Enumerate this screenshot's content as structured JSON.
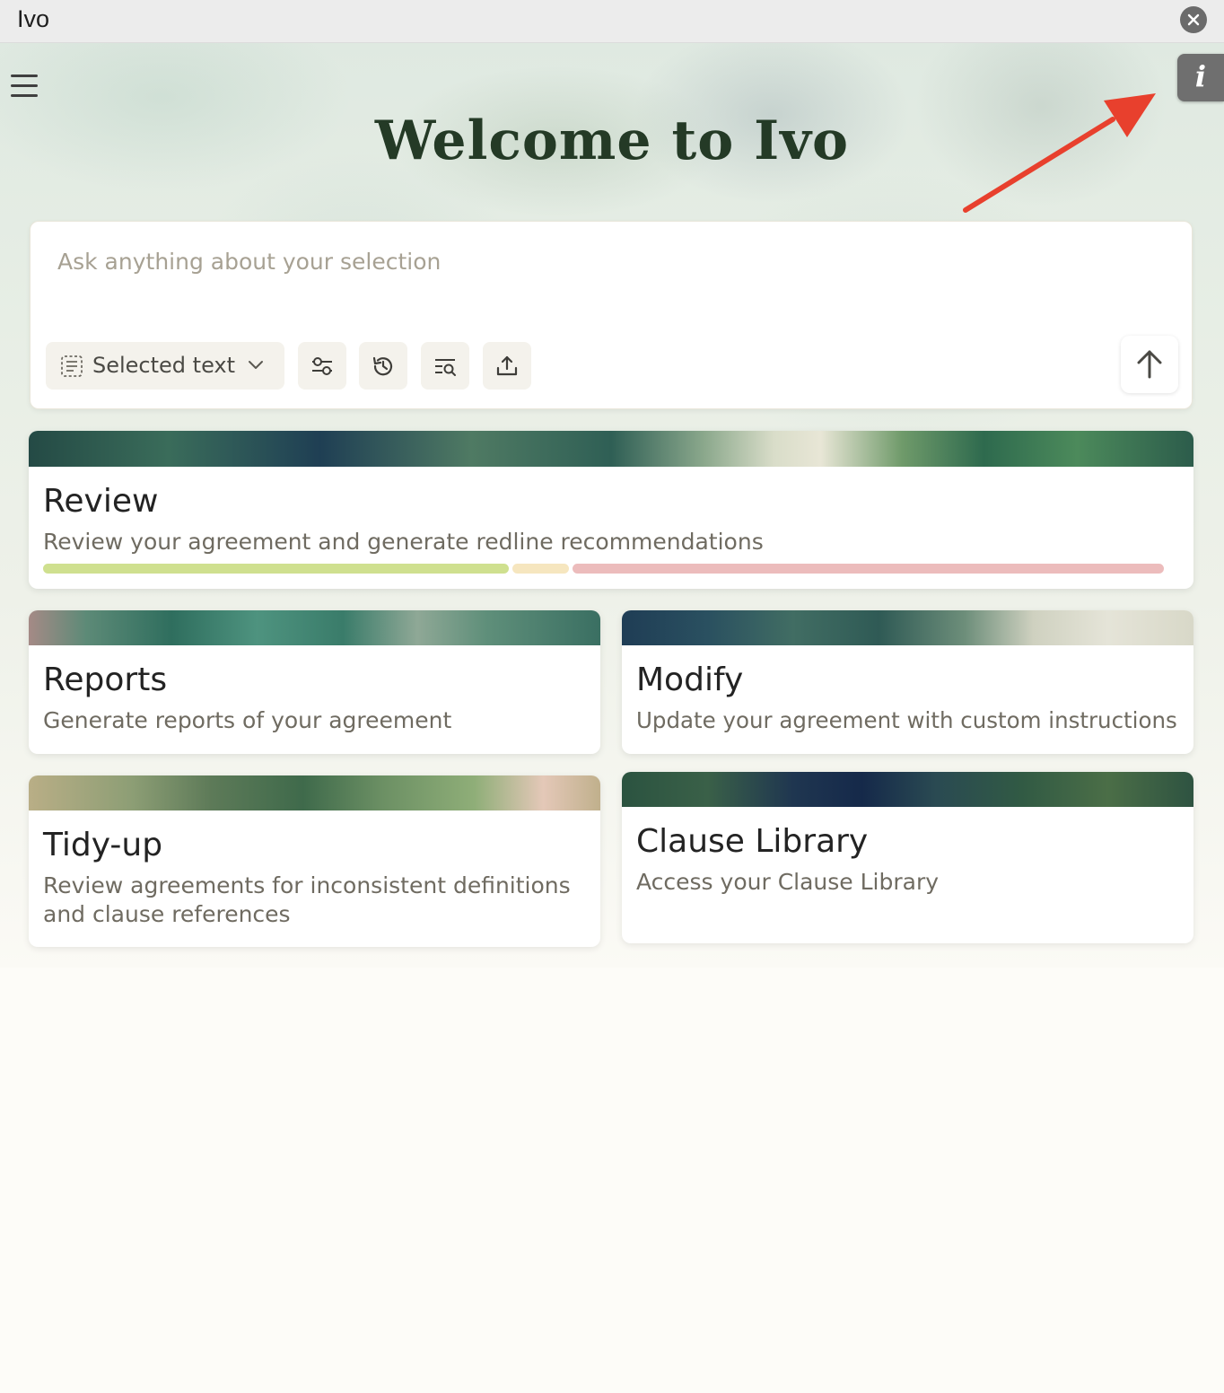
{
  "window": {
    "title": "Ivo"
  },
  "header": {
    "welcome": "Welcome to Ivo"
  },
  "prompt": {
    "placeholder": "Ask anything about your selection",
    "value": "",
    "selector_label": "Selected text"
  },
  "icons": {
    "close": "close-icon",
    "menu": "hamburger-menu-icon",
    "info": "info-icon",
    "selector": "text-selection-icon",
    "chevron": "chevron-down-icon",
    "settings": "sliders-icon",
    "history": "history-icon",
    "search": "search-list-icon",
    "upload": "upload-icon",
    "send": "arrow-up-icon"
  },
  "info_button": {
    "glyph": "i"
  },
  "cards": {
    "review": {
      "title": "Review",
      "description": "Review your agreement and generate redline recommendations",
      "progress_segments": [
        {
          "color": "#cfe08f",
          "share": 0.415
        },
        {
          "color": "#f6e6bf",
          "share": 0.05
        },
        {
          "color": "#ecbcbc",
          "share": 0.528
        }
      ]
    },
    "reports": {
      "title": "Reports",
      "description": "Generate reports of your agreement"
    },
    "modify": {
      "title": "Modify",
      "description": "Update your agreement with custom instructions"
    },
    "tidy_up": {
      "title": "Tidy-up",
      "description": "Review agreements for inconsistent definitions and clause references"
    },
    "clause_library": {
      "title": "Clause Library",
      "description": "Access your Clause Library"
    }
  },
  "colors": {
    "heading": "#243a26",
    "annotation_arrow": "#e8402d",
    "info_button": "#6f6f6f"
  }
}
